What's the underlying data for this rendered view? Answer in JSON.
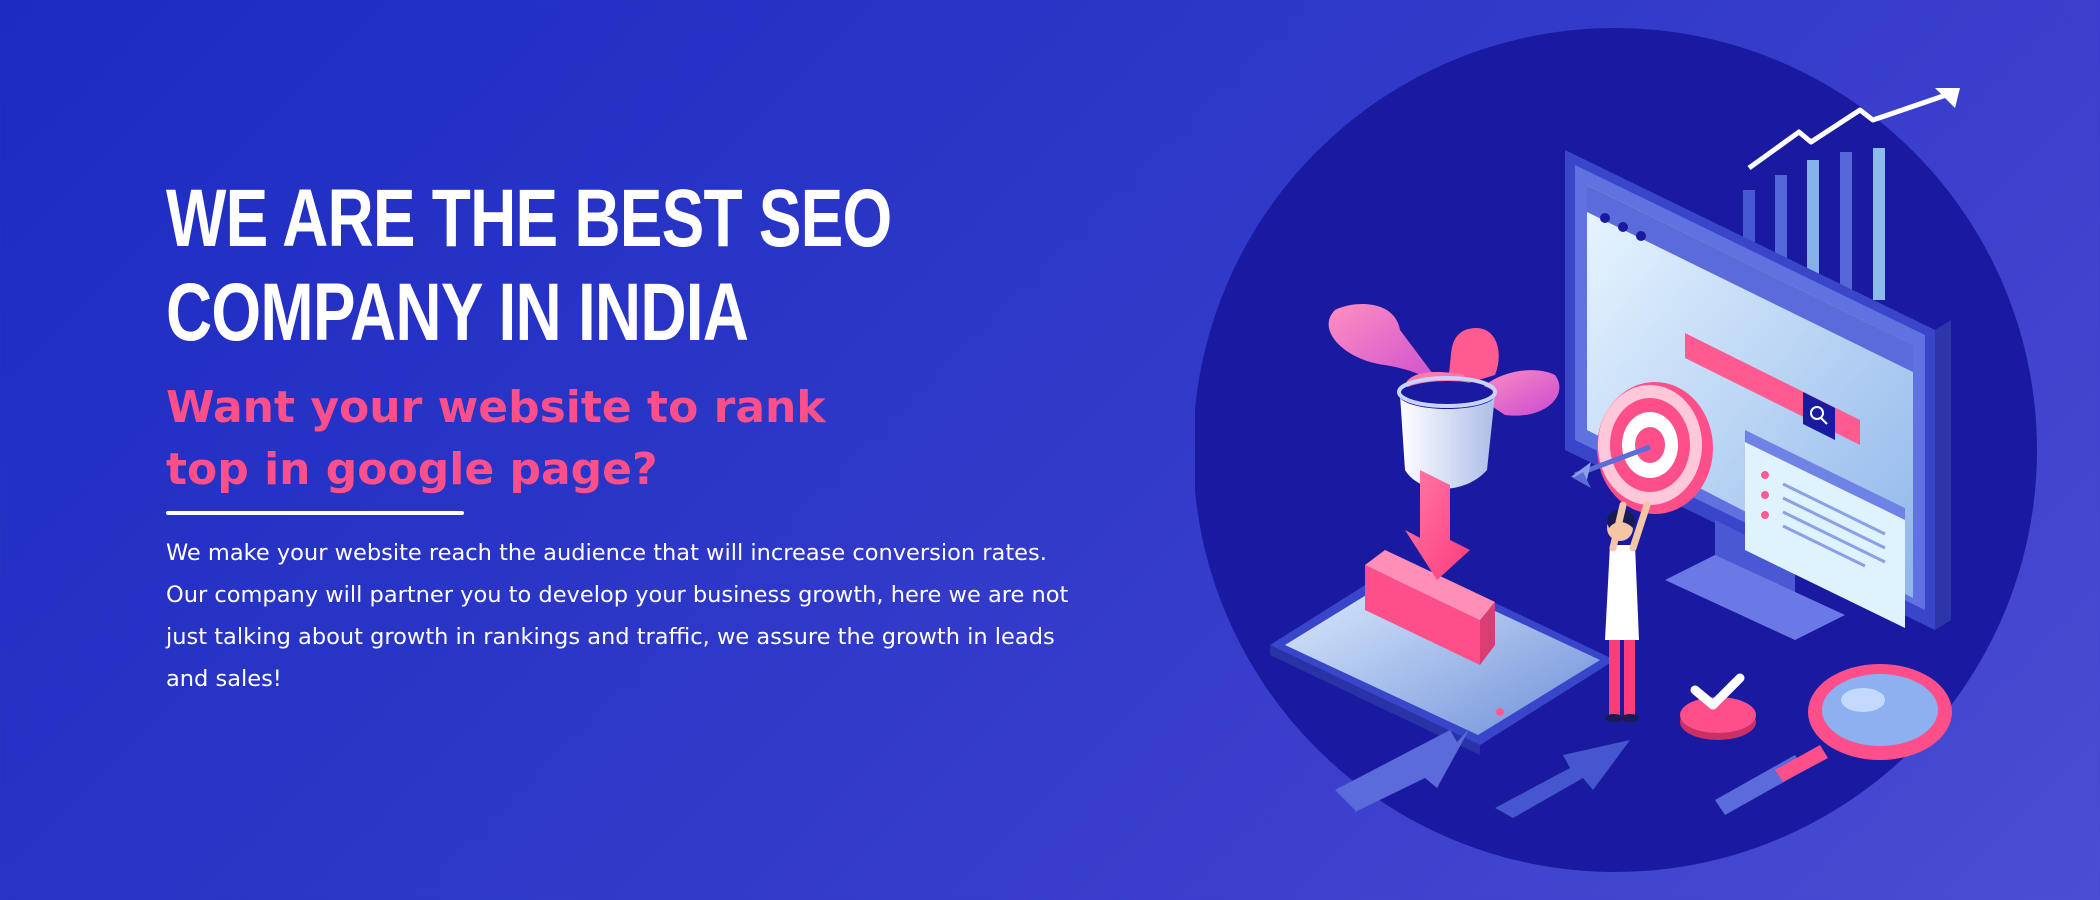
{
  "hero": {
    "heading": "WE ARE THE BEST SEO\nCOMPANY IN INDIA",
    "subheading": "Want your website to rank\ntop in google page?",
    "description": "We make your website reach the audience that will increase conversion rates. Our company will partner you to develop your business growth, here we are not just talking about growth in rankings and traffic, we assure the growth in leads and sales!"
  },
  "colors": {
    "background_start": "#1d2bc2",
    "background_end": "#4a4ed2",
    "accent_pink": "#ff4f8b",
    "text_white": "#ffffff",
    "circle_navy": "#1a1aa0"
  },
  "illustration": {
    "icons": [
      "growth-chart-icon",
      "monitor-icon",
      "search-bar-icon",
      "plant-icon",
      "target-icon",
      "arrow-dart-icon",
      "tablet-icon",
      "download-arrow-icon",
      "person-icon",
      "checkmark-icon",
      "magnifier-icon",
      "transfer-arrows-icon"
    ]
  }
}
